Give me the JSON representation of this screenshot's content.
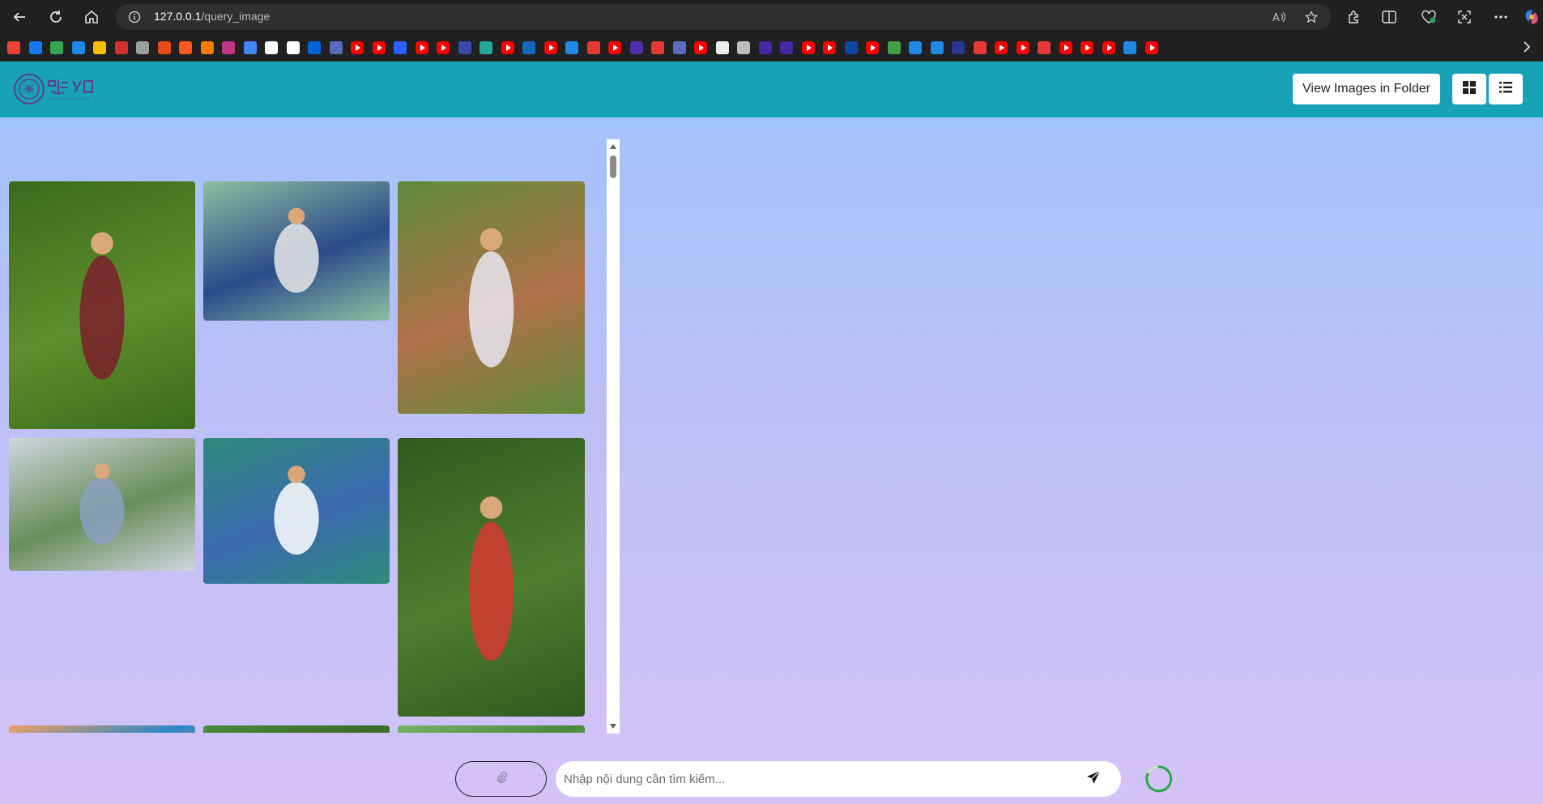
{
  "browser": {
    "url_host": "127.0.0.1",
    "url_path": "/query_image",
    "icons": [
      "back-icon",
      "refresh-icon",
      "home-icon",
      "info-icon",
      "read-aloud-icon",
      "favorite-star-icon",
      "extensions-icon",
      "split-screen-icon",
      "performance-icon",
      "screenshot-icon",
      "more-icon",
      "copilot-icon"
    ]
  },
  "bookmarks": {
    "colors": [
      "#ea4335",
      "#1877f2",
      "#34a853",
      "#1e88e5",
      "#fbbc04",
      "#d32f2f",
      "#9e9e9e",
      "#e64a19",
      "#ff5722",
      "#f57c00",
      "#c13584",
      "#4285f4",
      "#ffffff",
      "#ffffff",
      "#0063dc",
      "#5c6bc0",
      "#ff0000",
      "#ff0000",
      "#2962ff",
      "#ff0000",
      "#ff0000",
      "#3949ab",
      "#26a69a",
      "#ff0000",
      "#1565c0",
      "#ff0000",
      "#1e88e5",
      "#e53935",
      "#ff0000",
      "#512da8",
      "#e53935",
      "#5c6bc0",
      "#ff0000",
      "#eeeeee",
      "#bdbdbd",
      "#4527a0",
      "#4527a0",
      "#ff0000",
      "#ff0000",
      "#0d47a1",
      "#ff0000",
      "#43a047",
      "#1e88e5",
      "#1e88e5",
      "#283593",
      "#e53935",
      "#ff0000",
      "#ff0000",
      "#e53935",
      "#ff0000",
      "#ff0000",
      "#ff0000",
      "#1e88e5",
      "#ff0000"
    ]
  },
  "header": {
    "logo": "university-seal-logo",
    "view_folder_label": "View Images in Folder",
    "grid_view_icon": "grid-view-icon",
    "list_view_icon": "list-view-icon",
    "brand_color": "#17a2b8"
  },
  "gallery": {
    "images": [
      {
        "name": "kids-soccer-image",
        "palette": [
          "#5f8d2c",
          "#3a6b1c",
          "#7a1f2a"
        ]
      },
      {
        "name": "tennis-players-court-image",
        "palette": [
          "#2b4a8a",
          "#8fbfa0",
          "#e8e8e8"
        ]
      },
      {
        "name": "baseball-batter-ichiro-image",
        "palette": [
          "#b0714a",
          "#5f8a3a",
          "#e8e8f0"
        ]
      },
      {
        "name": "boy-batting-park-image",
        "palette": [
          "#6a8d5a",
          "#cfd6e0",
          "#8aa0c0"
        ]
      },
      {
        "name": "tennis-player-sequence-image",
        "palette": [
          "#3b6ab0",
          "#2f8a7a",
          "#ffffff"
        ]
      },
      {
        "name": "boy-swinging-bat-yard-image",
        "palette": [
          "#4f7d2f",
          "#2f5a1f",
          "#d6382f"
        ]
      },
      {
        "name": "child-cap-image",
        "palette": [
          "#2a86c8",
          "#f0a060",
          "#c84020"
        ]
      },
      {
        "name": "tennis-court-trees-image",
        "palette": [
          "#3a6a2a",
          "#4a8a3a",
          "#5a5a5a"
        ]
      },
      {
        "name": "person-field-house-image",
        "palette": [
          "#4a8a3a",
          "#7ab06a",
          "#5a6a7a"
        ]
      }
    ]
  },
  "search": {
    "placeholder": "Nhập nội dung cần tìm kiếm...",
    "attach_icon": "paperclip-icon",
    "send_icon": "send-icon"
  },
  "status": {
    "loading_icon": "loading-spinner-icon",
    "spinner_color": "#28a745"
  }
}
